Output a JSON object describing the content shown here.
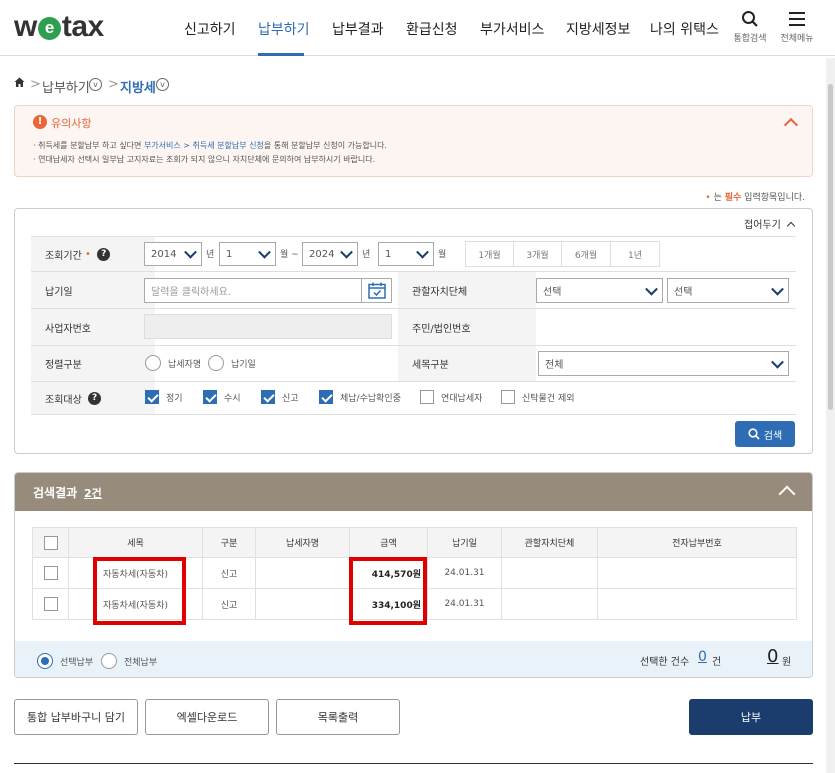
{
  "header": {
    "logo_pre": "w",
    "logo_e": "e",
    "logo_post": "tax",
    "nav": [
      "신고하기",
      "납부하기",
      "납부결과",
      "환급신청",
      "부가서비스",
      "지방세정보",
      "나의 위택스"
    ],
    "search_label": "통합검색",
    "menu_label": "전체메뉴"
  },
  "breadcrumb": {
    "level1": "납부하기",
    "level2": "지방세"
  },
  "notice": {
    "title": "유의사항",
    "line1_pre": "· 취득세를 분할납부 하고 싶다면 ",
    "line1_link": "부가서비스 > 취득세 분할납부 신청",
    "line1_post": "을 통해 분할납부 신청이 가능합니다.",
    "line2": "· 연대납세자 선택시 일부납 고지자료는 조회가 되지 않으니 자치단체에 문의하여 납부하시기 바랍니다."
  },
  "required_note": {
    "star": "•",
    "pre": "는 ",
    "bold": "필수",
    "post": " 입력항목입니다."
  },
  "search": {
    "collapse_label": "접어두기",
    "period_label": "조회기간",
    "period_star": "•",
    "start_year": "2014",
    "year_unit": "년",
    "start_month": "1",
    "month_unit_tilde": "월 ~",
    "end_year": "2024",
    "end_month": "1",
    "month_unit": "월",
    "quick": [
      "1개월",
      "3개월",
      "6개월",
      "1년"
    ],
    "due_label": "납기일",
    "due_placeholder": "달력을 클릭하세요.",
    "gov_label": "관할자치단체",
    "gov_select1": "선택",
    "gov_select2": "선택",
    "bizno_label": "사업자번호",
    "resno_label": "주민/법인번호",
    "sort_label": "정렬구분",
    "sort_options": [
      "납세자명",
      "납기일"
    ],
    "tax_item_label": "세목구분",
    "tax_item_value": "전체",
    "target_label": "조회대상",
    "targets": [
      {
        "label": "정기",
        "checked": true
      },
      {
        "label": "수시",
        "checked": true
      },
      {
        "label": "신고",
        "checked": true
      },
      {
        "label": "체납/수납확인중",
        "checked": true
      },
      {
        "label": "연대납세자",
        "checked": false
      },
      {
        "label": "신탁물건 제외",
        "checked": false
      }
    ],
    "search_button": "검색"
  },
  "results": {
    "title": "검색결과",
    "count": "2건",
    "columns": [
      "세목",
      "구분",
      "납세자명",
      "금액",
      "납기일",
      "관할자치단체",
      "전자납부번호"
    ],
    "rows": [
      {
        "tax": "자동차세(자동차)",
        "type": "신고",
        "payer": "",
        "amount": "414,570원",
        "due": "24.01.31",
        "gov": "",
        "epay": ""
      },
      {
        "tax": "자동차세(자동차)",
        "type": "신고",
        "payer": "",
        "amount": "334,100원",
        "due": "24.01.31",
        "gov": "",
        "epay": ""
      }
    ],
    "pay_select": "선택납부",
    "pay_all": "전체납부",
    "selected_count_label": "선택한 건수",
    "selected_count": "0",
    "count_unit": "건",
    "total": "0",
    "total_unit": "원"
  },
  "buttons": {
    "cart": "통합 납부바구니 담기",
    "excel": "엑셀다운로드",
    "print": "목록출력",
    "pay": "납부"
  },
  "colors": {
    "accent": "#2e6db4",
    "navy": "#1a3d6e",
    "result_header": "#978b7b",
    "highlight": "#e00000"
  }
}
